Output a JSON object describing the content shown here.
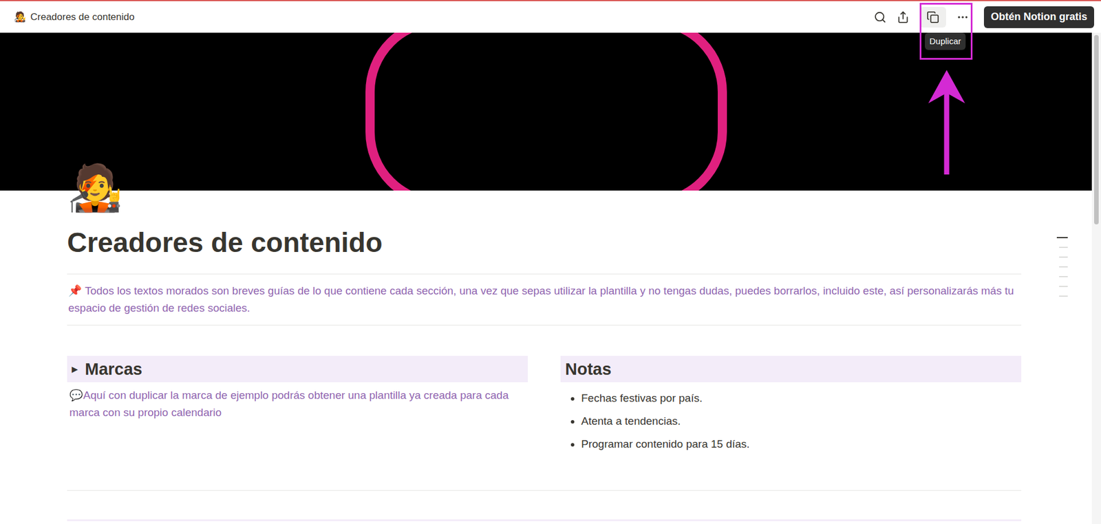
{
  "topbar": {
    "page_icon": "🧑‍🎤",
    "title": "Creadores de contenido",
    "cta": "Obtén Notion gratis",
    "tooltip": "Duplicar"
  },
  "page": {
    "icon": "🧑‍🎤",
    "title": "Creadores de contenido",
    "callout": {
      "icon": "📌",
      "text": "Todos los textos morados son breves guías de lo que contiene cada sección, una vez que sepas utilizar la plantilla y no tengas dudas, puedes borrarlos, incluido este, así personalizarás más tu espacio de gestión de redes sociales."
    }
  },
  "columns": [
    {
      "title": "Marcas",
      "toggle": "▶",
      "expanded": false,
      "body": {
        "icon": "💬",
        "text": "Aquí con duplicar la marca de ejemplo podrás obtener una plantilla ya creada para cada marca con su propio calendario"
      },
      "bullets": []
    },
    {
      "title": "Notas",
      "toggle": "",
      "expanded": false,
      "body": null,
      "bullets": [
        "Fechas festivas por país.",
        "Atenta a tendencias.",
        "Programar contenido para 15 días."
      ]
    }
  ],
  "toc": [
    {
      "selected": true
    },
    {
      "selected": false
    },
    {
      "selected": false
    },
    {
      "selected": false
    },
    {
      "selected": false
    },
    {
      "selected": false
    },
    {
      "selected": false
    }
  ]
}
